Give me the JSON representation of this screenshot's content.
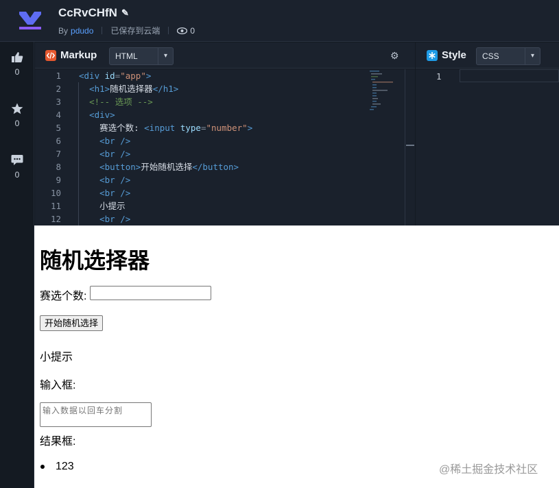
{
  "header": {
    "title": "CcRvCHfN",
    "by_prefix": "By",
    "author": "pdudo",
    "save_status": "已保存到云端",
    "view_count": "0"
  },
  "rail": {
    "likes": "0",
    "stars": "0",
    "comments": "0"
  },
  "markup_panel": {
    "label": "Markup",
    "language": "HTML"
  },
  "style_panel": {
    "label": "Style",
    "language": "CSS",
    "line_number": "1"
  },
  "code_lines": [
    {
      "n": "1",
      "parts": [
        [
          "tag",
          "<div "
        ],
        [
          "attr",
          "id"
        ],
        [
          "punc",
          "="
        ],
        [
          "str",
          "\"app\""
        ],
        [
          "tag",
          ">"
        ]
      ]
    },
    {
      "n": "2",
      "parts": [
        [
          "plain",
          "  "
        ],
        [
          "tag",
          "<h1>"
        ],
        [
          "plain",
          "随机选择器"
        ],
        [
          "tag",
          "</h1>"
        ]
      ]
    },
    {
      "n": "3",
      "parts": [
        [
          "plain",
          "  "
        ],
        [
          "cmt",
          "<!-- 选项 -->"
        ]
      ]
    },
    {
      "n": "4",
      "parts": [
        [
          "plain",
          "  "
        ],
        [
          "tag",
          "<div>"
        ]
      ]
    },
    {
      "n": "5",
      "parts": [
        [
          "plain",
          "    赛选个数: "
        ],
        [
          "tag",
          "<input "
        ],
        [
          "attr",
          "type"
        ],
        [
          "punc",
          "="
        ],
        [
          "str",
          "\"number\""
        ],
        [
          "tag",
          ">"
        ]
      ]
    },
    {
      "n": "6",
      "parts": [
        [
          "plain",
          "    "
        ],
        [
          "tag",
          "<br />"
        ]
      ]
    },
    {
      "n": "7",
      "parts": [
        [
          "plain",
          "    "
        ],
        [
          "tag",
          "<br />"
        ]
      ]
    },
    {
      "n": "8",
      "parts": [
        [
          "plain",
          "    "
        ],
        [
          "tag",
          "<button>"
        ],
        [
          "plain",
          "开始随机选择"
        ],
        [
          "tag",
          "</button>"
        ]
      ]
    },
    {
      "n": "9",
      "parts": [
        [
          "plain",
          "    "
        ],
        [
          "tag",
          "<br />"
        ]
      ]
    },
    {
      "n": "10",
      "parts": [
        [
          "plain",
          "    "
        ],
        [
          "tag",
          "<br />"
        ]
      ]
    },
    {
      "n": "11",
      "parts": [
        [
          "plain",
          "    小提示"
        ]
      ]
    },
    {
      "n": "12",
      "parts": [
        [
          "plain",
          "    "
        ],
        [
          "tag",
          "<br />"
        ]
      ]
    }
  ],
  "preview": {
    "heading": "随机选择器",
    "count_label": "赛选个数:",
    "start_button": "开始随机选择",
    "tip": "小提示",
    "input_box_label": "输入框:",
    "textarea_placeholder": "输入数据以回车分割",
    "result_box_label": "结果框:",
    "result_item": "123"
  },
  "watermark": "@稀土掘金技术社区",
  "colors": {
    "accent_blue": "#5aa0ff",
    "markup_icon": "#e4572e",
    "style_icon": "#1e9be6",
    "logo_purple": "#7b5cff"
  }
}
